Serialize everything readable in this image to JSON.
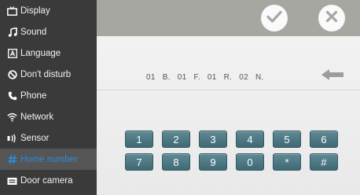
{
  "sidebar": {
    "items": [
      {
        "label": "Display",
        "icon": "tv-icon"
      },
      {
        "label": "Sound",
        "icon": "music-note-icon"
      },
      {
        "label": "Language",
        "icon": "language-icon"
      },
      {
        "label": "Don't disturb",
        "icon": "block-icon"
      },
      {
        "label": "Phone",
        "icon": "phone-icon"
      },
      {
        "label": "Network",
        "icon": "wifi-icon"
      },
      {
        "label": "Sensor",
        "icon": "sensor-icon"
      },
      {
        "label": "Home number",
        "icon": "hash-icon",
        "active": true
      },
      {
        "label": "Door camera",
        "icon": "camera-icon"
      }
    ]
  },
  "toolbar": {
    "confirm_icon": "check-icon",
    "cancel_icon": "close-icon"
  },
  "address": {
    "parts": [
      "01",
      "B.",
      "01",
      "F.",
      "01",
      "R.",
      "02",
      "N."
    ]
  },
  "keypad": {
    "keys": [
      "1",
      "2",
      "3",
      "4",
      "5",
      "6",
      "7",
      "8",
      "9",
      "0",
      "*",
      "#"
    ]
  },
  "colors": {
    "sidebar_bg": "#3a3a3a",
    "active_accent": "#2f8ad8",
    "topbar_bg": "#a7a7a2",
    "key_bg": "#4f7a85"
  }
}
